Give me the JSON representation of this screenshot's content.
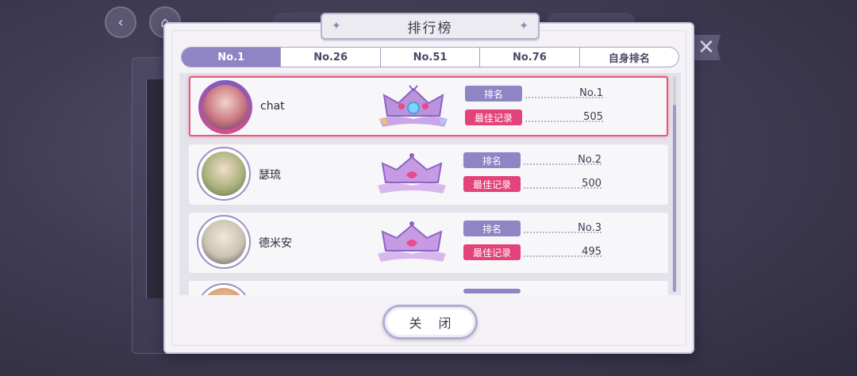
{
  "dialog": {
    "title": "排行榜",
    "close_label": "关 闭"
  },
  "tabs": [
    {
      "label": "No.1",
      "active": true
    },
    {
      "label": "No.26",
      "active": false
    },
    {
      "label": "No.51",
      "active": false
    },
    {
      "label": "No.76",
      "active": false
    },
    {
      "label": "自身排名",
      "active": false
    }
  ],
  "labels": {
    "rank": "排名",
    "best": "最佳记录"
  },
  "rows": [
    {
      "name": "chat",
      "rank": "No.1",
      "best": "505",
      "avatar_color": "#c9757f",
      "highlight": true
    },
    {
      "name": "瑟琉",
      "rank": "No.2",
      "best": "500",
      "avatar_color": "#a9b27e",
      "highlight": false
    },
    {
      "name": "德米安",
      "rank": "No.3",
      "best": "495",
      "avatar_color": "#c9c4b4",
      "highlight": false
    }
  ],
  "background": {
    "back_icon": "back-arrow-icon",
    "home_icon": "home-icon",
    "close_icon": "x-icon"
  },
  "colors": {
    "accent_purple": "#8f84c4",
    "accent_pink": "#e3437a",
    "highlight_border": "#e35a7e"
  }
}
